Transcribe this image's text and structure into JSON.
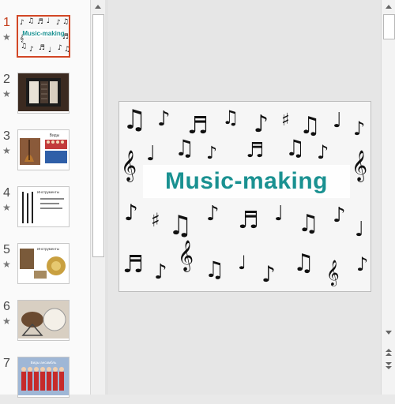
{
  "slides": [
    {
      "number": "1",
      "star": "★",
      "title": "Music-making",
      "active": true
    },
    {
      "number": "2",
      "star": "★"
    },
    {
      "number": "3",
      "star": "★",
      "caption": "Виды"
    },
    {
      "number": "4",
      "star": "★",
      "caption": "Инструменты"
    },
    {
      "number": "5",
      "star": "★",
      "caption": "Инструменты"
    },
    {
      "number": "6",
      "star": "★"
    },
    {
      "number": "7",
      "caption": "Виды ансамбль"
    }
  ],
  "current_slide": {
    "title": "Music-making",
    "title_color": "#1a9191"
  },
  "colors": {
    "active_number": "#c43e1c",
    "active_border": "#d24726"
  },
  "icons": {
    "scroll_up": "triangle-up",
    "scroll_down": "triangle-down",
    "prev_slide": "double-up",
    "next_slide": "double-down"
  }
}
